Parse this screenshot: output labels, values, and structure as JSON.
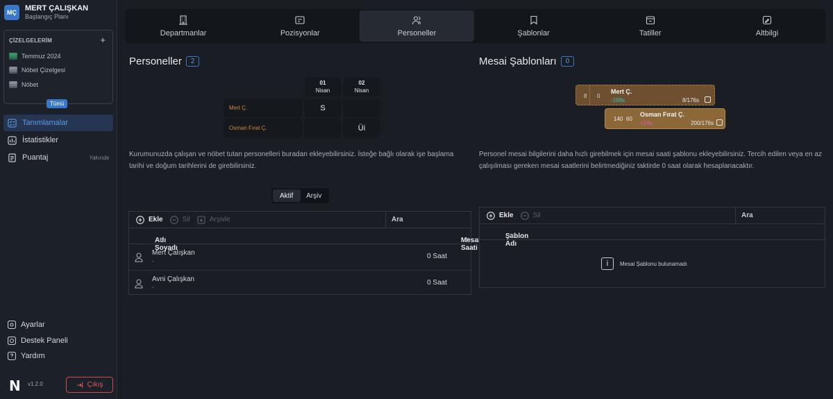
{
  "user": {
    "initials": "MÇ",
    "name": "MERT ÇALIŞKAN",
    "plan": "Başlangıç Planı"
  },
  "schedules": {
    "header": "ÇİZELGELERİM",
    "add": "+",
    "items": [
      {
        "label": "Temmuz 2024",
        "icon": "stack-green-icon"
      },
      {
        "label": "Nöbet Çizelgesi",
        "icon": "stack-grey-icon"
      },
      {
        "label": "Nöbet",
        "icon": "stack-grey-icon"
      }
    ],
    "all_label": "Tümü"
  },
  "nav": [
    {
      "label": "Tanımlamalar",
      "active": true
    },
    {
      "label": "İstatistikler"
    },
    {
      "label": "Puantaj",
      "badge": "Yakında"
    }
  ],
  "bottom_nav": [
    "Ayarlar",
    "Destek Paneli",
    "Yardım"
  ],
  "footer": {
    "logo": "N",
    "version": "v1.2.0",
    "logout": "Çıkış"
  },
  "tabs": [
    "Departmanlar",
    "Pozisyonlar",
    "Personeller",
    "Şablonlar",
    "Tatiller",
    "Altbilgi"
  ],
  "active_tab": "Personeller",
  "personnel": {
    "title": "Personeller",
    "count": "2",
    "preview": {
      "days": [
        {
          "day": "01",
          "month": "Nisan"
        },
        {
          "day": "02",
          "month": "Nisan"
        }
      ],
      "rows": [
        {
          "name": "Mert Ç.",
          "cells": [
            "S",
            ""
          ]
        },
        {
          "name": "Osman Fırat Ç.",
          "cells": [
            "",
            "Üi"
          ]
        }
      ]
    },
    "description": "Kurumunuzda çalışan ve nöbet tutan personelleri buradan ekleyebilirsiniz. İsteğe bağlı olarak işe başlama tarihi ve doğum tarihlerini de girebilirsiniz.",
    "segment": {
      "active": "Aktif",
      "archive": "Arşiv"
    },
    "toolbar": {
      "add": "Ekle",
      "delete": "Sil",
      "archive": "Arşivle",
      "search": "Ara"
    },
    "columns": {
      "name": "Adı Soyadı",
      "hours": "Mesai Saati"
    },
    "rows": [
      {
        "name": "Mert Çalışkan",
        "sub": "-",
        "hours": "0 Saat"
      },
      {
        "name": "Avni Çalışkan",
        "sub": "-",
        "hours": "0 Saat"
      }
    ]
  },
  "templates": {
    "title": "Mesai Şablonları",
    "count": "0",
    "preview": [
      {
        "a": "8",
        "b": "0",
        "name": "Mert Ç.",
        "delta": "-168s",
        "ratio": "8/176s"
      },
      {
        "a": "140",
        "b": "60",
        "name": "Osman Fırat Ç.",
        "delta": "+24s",
        "ratio": "200/176s"
      }
    ],
    "description": "Personel mesai bilgilerini daha hızlı girebilmek için mesai saati şablonu ekleyebilirsiniz. Tercih edilen veya en az çalışılması gereken mesai saatlerini belirtmediğiniz taktirde 0 saat olarak hesaplanacaktır.",
    "toolbar": {
      "add": "Ekle",
      "delete": "Sil",
      "search": "Ara"
    },
    "columns": {
      "name": "Şablon Adı"
    },
    "empty": "Mesai Şablonu bulunamadı"
  },
  "colors": {
    "accent": "#3a78c9",
    "orange": "#d0893a",
    "danger": "#e05a5a",
    "teal": "#2ec4b6",
    "pink": "#e05ab0"
  }
}
